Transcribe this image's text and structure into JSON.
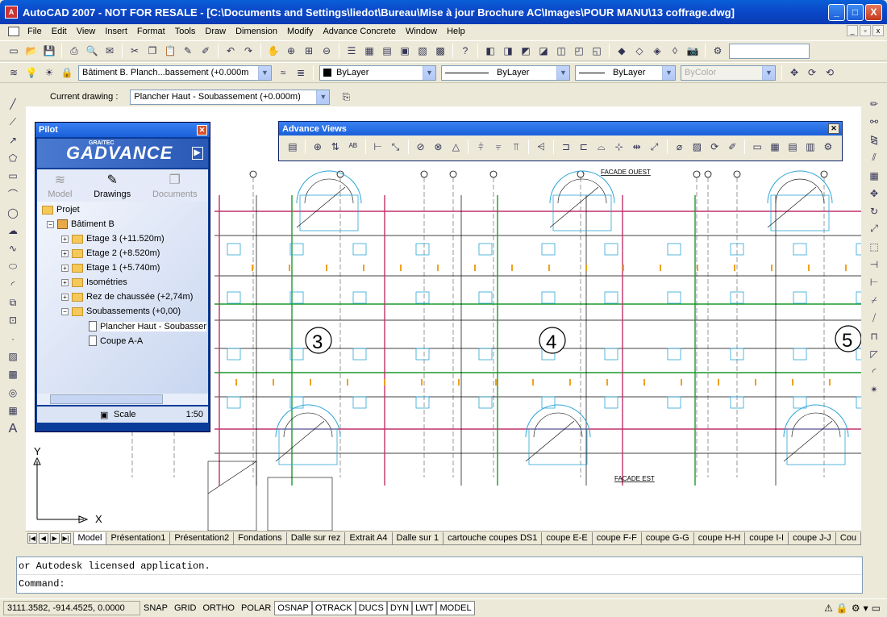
{
  "window": {
    "title": "AutoCAD 2007 - NOT FOR RESALE - [C:\\Documents and Settings\\liedot\\Bureau\\Mise à jour Brochure AC\\Images\\POUR MANU\\13 coffrage.dwg]",
    "minimize": "_",
    "maximize": "□",
    "close": "X"
  },
  "menu": [
    "File",
    "Edit",
    "View",
    "Insert",
    "Format",
    "Tools",
    "Draw",
    "Dimension",
    "Modify",
    "Advance Concrete",
    "Window",
    "Help"
  ],
  "layers": {
    "current_layer": "Bâtiment B. Planch...bassement (+0.000m",
    "color": "ByLayer",
    "linetype": "ByLayer",
    "lineweight": "ByLayer",
    "plotstyle": "ByColor"
  },
  "current_drawing": {
    "label": "Current drawing :",
    "value": "Plancher Haut - Soubassement (+0.000m)"
  },
  "pilot": {
    "title": "Pilot",
    "brand": "ADVANCE",
    "brand_prefix": "G",
    "brand_sub": "GRAITEC",
    "tabs": [
      "Model",
      "Drawings",
      "Documents"
    ],
    "tree": [
      {
        "label": "Projet",
        "level": 0,
        "icon": "folder"
      },
      {
        "label": "Bâtiment B",
        "level": 1,
        "icon": "building"
      },
      {
        "label": "Etage 3 (+11.520m)",
        "level": 2,
        "icon": "folder"
      },
      {
        "label": "Etage 2 (+8.520m)",
        "level": 2,
        "icon": "folder"
      },
      {
        "label": "Etage 1 (+5.740m)",
        "level": 2,
        "icon": "folder"
      },
      {
        "label": "Isométries",
        "level": 2,
        "icon": "folder"
      },
      {
        "label": "Rez de chaussée (+2,74m)",
        "level": 2,
        "icon": "folder"
      },
      {
        "label": "Soubassements (+0,00)",
        "level": 2,
        "icon": "folder"
      },
      {
        "label": "Plancher Haut - Soubasser",
        "level": 3,
        "icon": "doc"
      },
      {
        "label": "Coupe A-A",
        "level": 3,
        "icon": "doc"
      }
    ],
    "scale_label": "Scale",
    "scale_value": "1:50"
  },
  "advance_views": {
    "title": "Advance Views"
  },
  "drawing": {
    "labels": {
      "facade_ouest": "FACADE OUEST",
      "facade_est": "FACADE EST",
      "axis3": "3",
      "axis4": "4",
      "axis5": "5",
      "ucs_x": "X",
      "ucs_y": "Y"
    }
  },
  "layout_tabs": [
    "Model",
    "Présentation1",
    "Présentation2",
    "Fondations",
    "Dalle sur rez",
    "Extrait A4",
    "Dalle sur 1",
    "cartouche coupes DS1",
    "coupe E-E",
    "coupe F-F",
    "coupe G-G",
    "coupe H-H",
    "coupe I-I",
    "coupe J-J",
    "Cou"
  ],
  "command": {
    "history": "or Autodesk licensed application.",
    "prompt": "Command:"
  },
  "status": {
    "coords": "3111.3582, -914.4525, 0.0000",
    "toggles": [
      "SNAP",
      "GRID",
      "ORTHO",
      "POLAR",
      "OSNAP",
      "OTRACK",
      "DUCS",
      "DYN",
      "LWT",
      "MODEL"
    ],
    "active": [
      "OSNAP",
      "OTRACK",
      "DUCS",
      "DYN",
      "LWT",
      "MODEL"
    ]
  }
}
